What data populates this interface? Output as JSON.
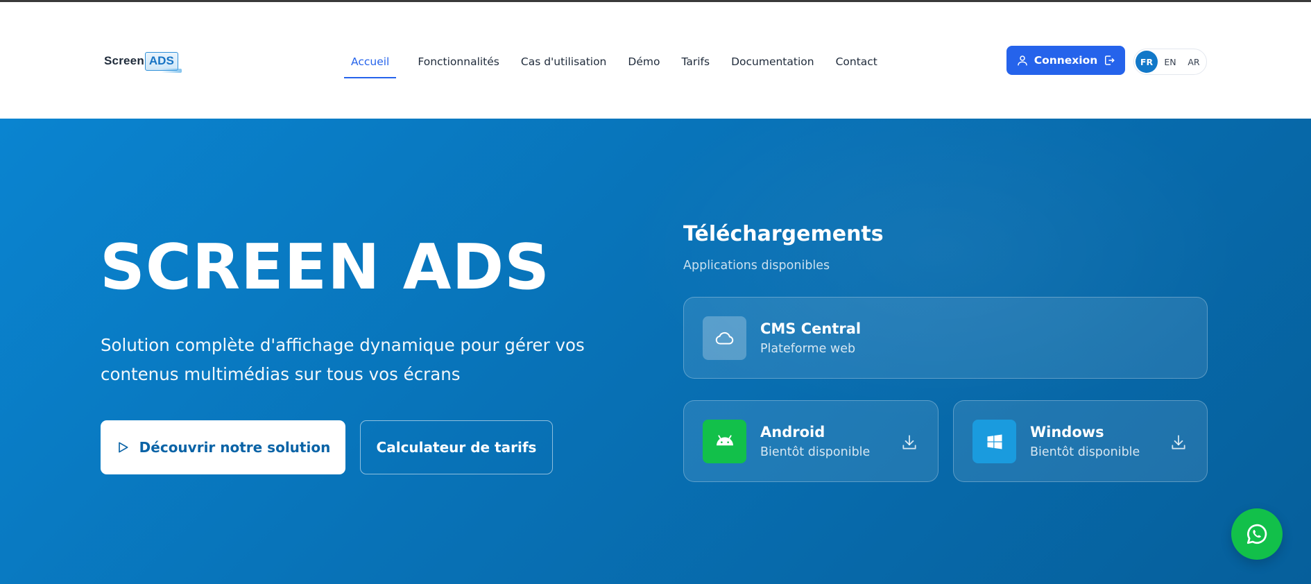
{
  "logo": {
    "text_prefix": "Screen",
    "text_boxed": "ADS"
  },
  "nav": {
    "items": [
      {
        "label": "Accueil",
        "active": true
      },
      {
        "label": "Fonctionnalités",
        "active": false
      },
      {
        "label": "Cas d'utilisation",
        "active": false
      },
      {
        "label": "Démo",
        "active": false
      },
      {
        "label": "Tarifs",
        "active": false
      },
      {
        "label": "Documentation",
        "active": false
      },
      {
        "label": "Contact",
        "active": false
      }
    ]
  },
  "header": {
    "login_label": "Connexion",
    "languages": [
      {
        "code": "FR",
        "active": true
      },
      {
        "code": "EN",
        "active": false
      },
      {
        "code": "AR",
        "active": false
      }
    ]
  },
  "hero": {
    "title": "SCREEN ADS",
    "subtitle": "Solution complète d'affichage dynamique pour gérer vos contenus multimédias sur tous vos écrans",
    "primary_button": "Découvrir notre solution",
    "secondary_button": "Calculateur de tarifs"
  },
  "downloads": {
    "title": "Téléchargements",
    "subtitle": "Applications disponibles",
    "cards": [
      {
        "name": "CMS Central",
        "desc": "Plateforme web",
        "icon": "cloud-icon"
      },
      {
        "name": "Android",
        "desc": "Bientôt disponible",
        "icon": "android-icon"
      },
      {
        "name": "Windows",
        "desc": "Bientôt disponible",
        "icon": "windows-icon"
      }
    ]
  },
  "colors": {
    "accent": "#2563eb",
    "hero_start": "#0a84d0",
    "hero_end": "#065f9b",
    "android": "#12c04a",
    "windows": "#1a9bde",
    "whatsapp": "#12c04a"
  }
}
